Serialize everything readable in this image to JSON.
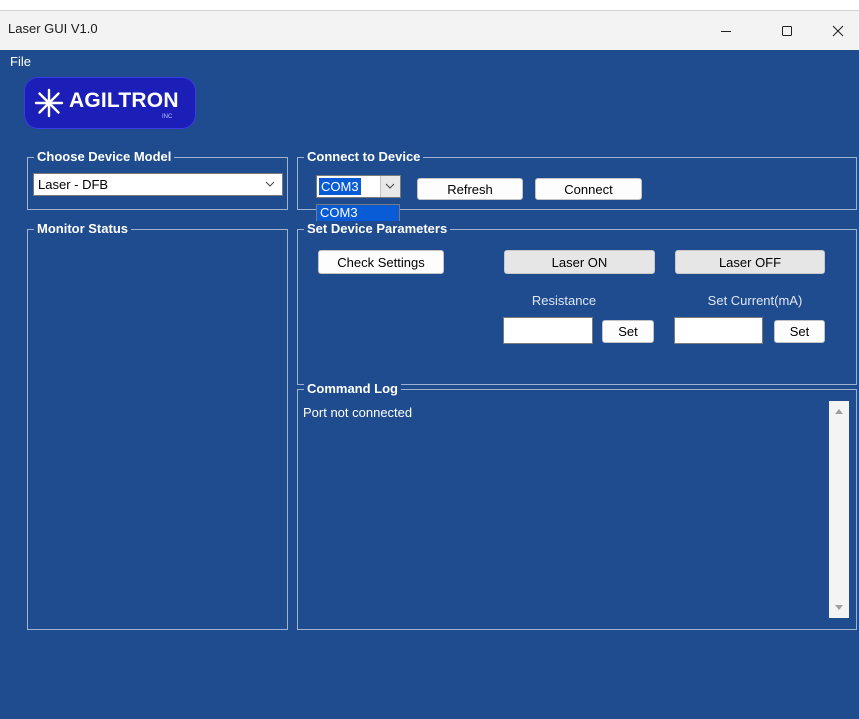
{
  "window": {
    "title": "Laser GUI V1.0"
  },
  "menu": {
    "file": "File"
  },
  "logo": {
    "text": "AGILTRON",
    "sub": "INC"
  },
  "device_model": {
    "label": "Choose Device Model",
    "selected": "Laser - DFB"
  },
  "connect": {
    "label": "Connect to Device",
    "port_selected": "COM3",
    "port_options": [
      "COM3"
    ],
    "refresh_label": "Refresh",
    "connect_label": "Connect"
  },
  "monitor": {
    "label": "Monitor Status"
  },
  "parameters": {
    "label": "Set Device Parameters",
    "check_settings_label": "Check Settings",
    "laser_on_label": "Laser ON",
    "laser_off_label": "Laser OFF",
    "resistance_label": "Resistance",
    "resistance_value": "",
    "resistance_set_label": "Set",
    "current_label": "Set Current(mA)",
    "current_value": "",
    "current_set_label": "Set"
  },
  "log": {
    "label": "Command Log",
    "text": "Port not connected"
  },
  "colors": {
    "background": "#1f4c8f",
    "logo": "#1b1fb8",
    "selection": "#0a5bd6"
  },
  "icons": {
    "minimize": "minimize-icon",
    "maximize": "maximize-icon",
    "close": "close-icon",
    "dropdown": "chevron-down-icon",
    "scroll_up": "scroll-up-arrow-icon",
    "scroll_down": "scroll-down-arrow-icon"
  }
}
